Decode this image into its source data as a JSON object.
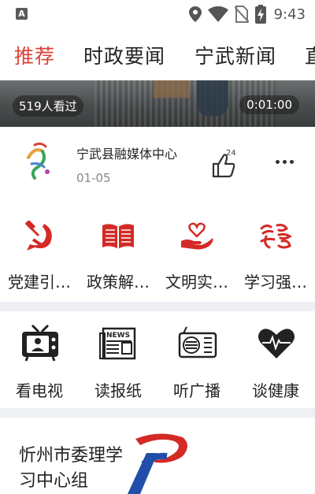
{
  "status_bar": {
    "time": "9:43",
    "left_badge": "A",
    "icons": [
      "location-icon",
      "wifi-icon",
      "no-sim-icon",
      "battery-charging-icon"
    ]
  },
  "tabs": [
    "推荐",
    "时政要闻",
    "宁武新闻",
    "直"
  ],
  "active_tab": "推荐",
  "video": {
    "views": "519人看过",
    "duration": "0:01:00"
  },
  "source": {
    "name": "宁武县融媒体中心",
    "date": "01-05",
    "likes": "24"
  },
  "quick_entries": [
    {
      "label": "党建引…",
      "icon": "hammer-sickle-icon"
    },
    {
      "label": "政策解…",
      "icon": "open-book-icon"
    },
    {
      "label": "文明实…",
      "icon": "heart-hand-icon"
    },
    {
      "label": "学习强…",
      "icon": "xuexi-calligraphy-icon"
    }
  ],
  "media_entries": [
    {
      "label": "看电视",
      "icon": "tv-icon"
    },
    {
      "label": "读报纸",
      "icon": "newspaper-icon"
    },
    {
      "label": "听广播",
      "icon": "radio-icon"
    },
    {
      "label": "谈健康",
      "icon": "heartbeat-icon"
    }
  ],
  "card": {
    "title": "忻州市委理学习中心组"
  },
  "colors": {
    "accent": "#d9423a",
    "divider": "#eef0f5"
  }
}
